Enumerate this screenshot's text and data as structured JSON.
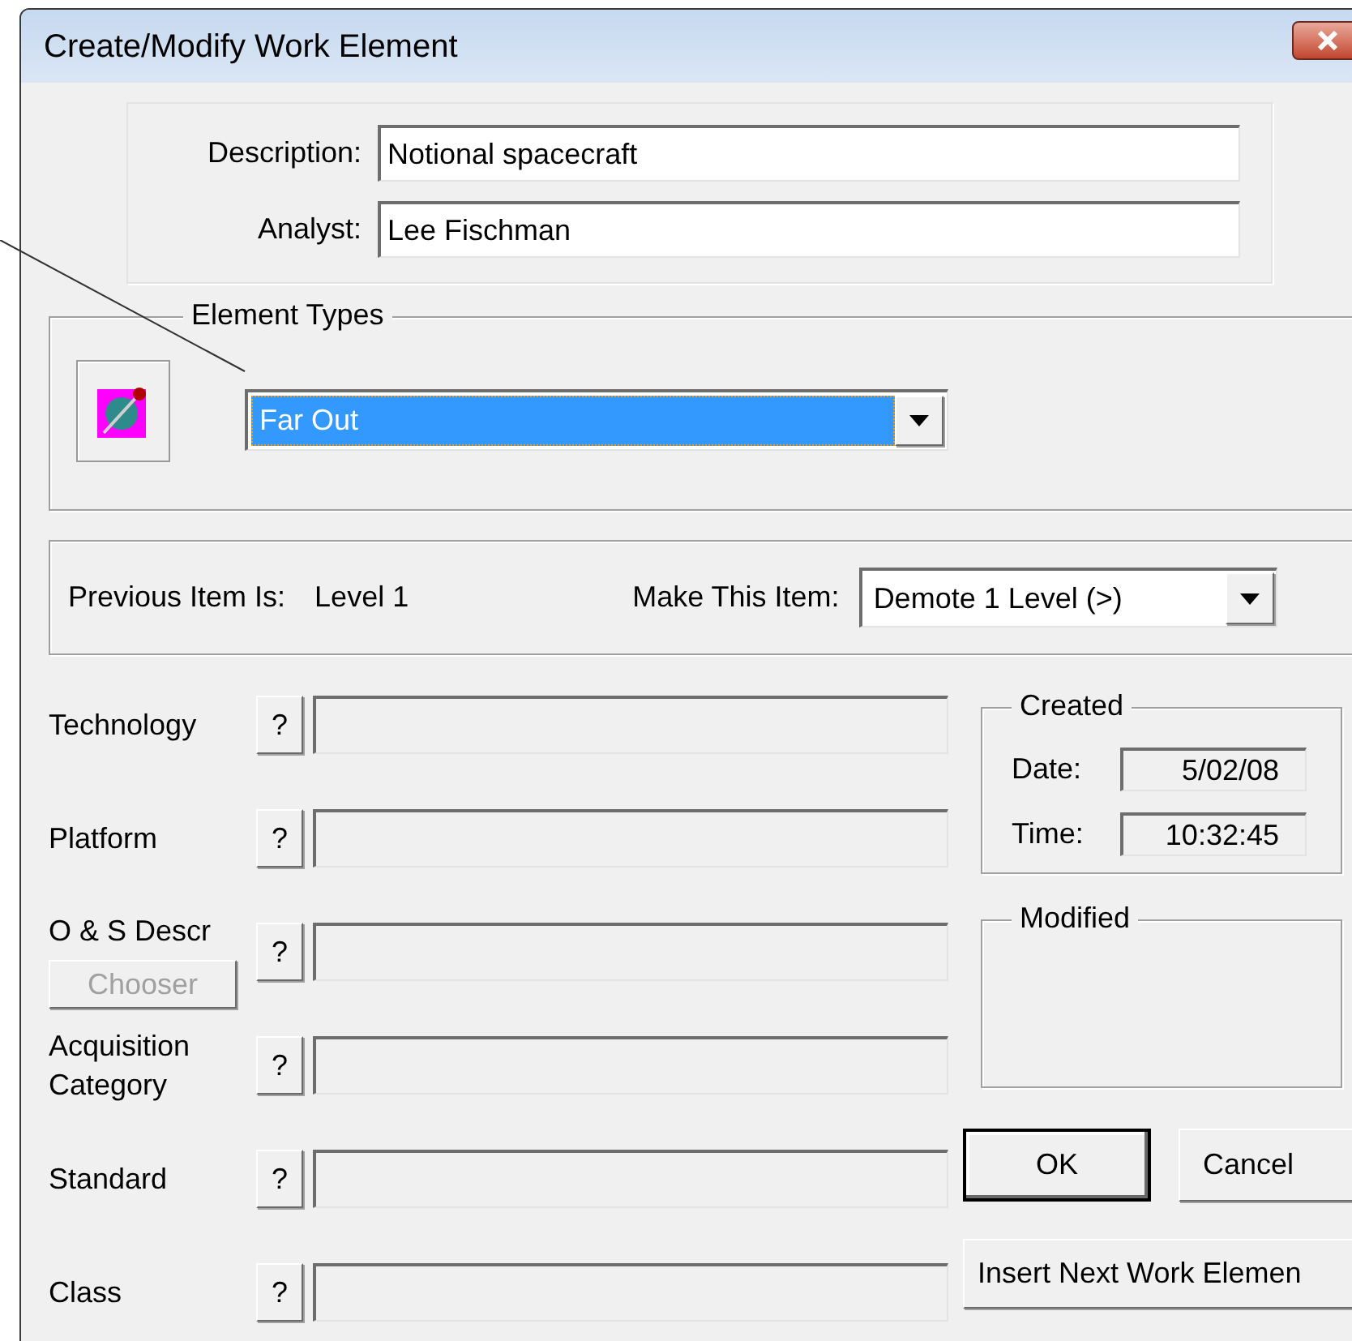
{
  "window": {
    "title": "Create/Modify Work Element"
  },
  "header": {
    "fields": [
      {
        "label": "Description:",
        "value": "Notional spacecraft"
      },
      {
        "label": "Analyst:",
        "value": "Lee Fischman"
      }
    ]
  },
  "element_types": {
    "legend": "Element Types",
    "selection": "Far Out",
    "focused": true
  },
  "level": {
    "previous_label": "Previous Item Is:",
    "previous_value": "Level 1",
    "make_label": "Make This Item:",
    "make_value": "Demote 1 Level (>)"
  },
  "attributes": [
    {
      "kind": "plain",
      "label": "Technology",
      "help": "?",
      "disabled": true
    },
    {
      "kind": "plain",
      "label": "Platform",
      "help": "?",
      "disabled": true
    },
    {
      "kind": "chooser",
      "label": "O & S Descr",
      "help": "?",
      "disabled": true,
      "chooser": {
        "label": "Chooser",
        "disabled": true
      }
    },
    {
      "kind": "plain",
      "label": "Acquisition Category",
      "help": "?",
      "disabled": true
    },
    {
      "kind": "plain",
      "label": "Standard",
      "help": "?",
      "disabled": true
    },
    {
      "kind": "plain",
      "label": "Class",
      "help": "?",
      "disabled": true
    }
  ],
  "created": {
    "legend": "Created",
    "date_label": "Date:",
    "date": "5/02/08",
    "time_label": "Time:",
    "time": "10:32:45"
  },
  "modified": {
    "legend": "Modified"
  },
  "buttons": [
    {
      "kind": "default",
      "label": "OK"
    },
    {
      "kind": "normal",
      "label": "Cancel"
    },
    {
      "kind": "wide",
      "label": "Insert Next Work Elemen"
    }
  ]
}
